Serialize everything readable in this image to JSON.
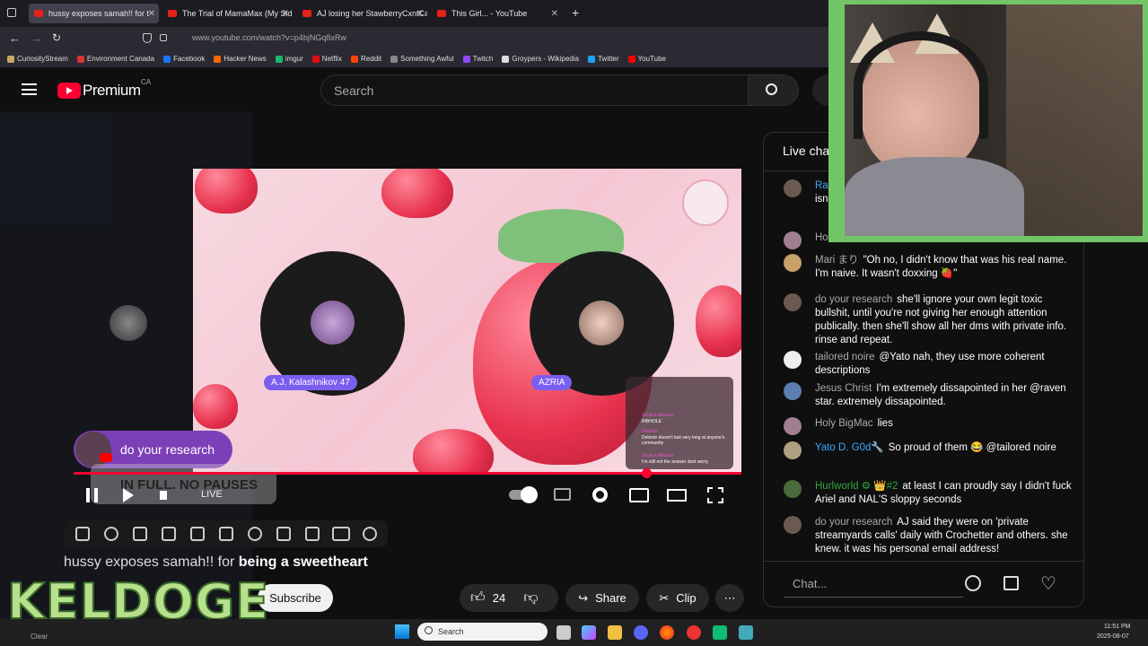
{
  "browser": {
    "tabs": [
      {
        "title": "hussy exposes samah!! for t",
        "active": true
      },
      {
        "title": "The Trial of MamaMax (My Side"
      },
      {
        "title": "AJ losing her StawberryCxntCal"
      },
      {
        "title": "This Girl... - YouTube"
      }
    ],
    "url": "www.youtube.com/watch?v=p4bjNGq8xRw",
    "bookmarks": [
      "CuriosityStream",
      "Environment Canada",
      "Facebook",
      "Hacker News",
      "imgur",
      "Netflix",
      "Reddit",
      "Something Awful",
      "Twitch",
      "Groypers - Wikipedia",
      "Twitter",
      "YouTube"
    ]
  },
  "youtube": {
    "logo": "Premium",
    "region": "CA",
    "search_placeholder": "Search",
    "video": {
      "left_name": "A.J. Kalashnikov 47",
      "right_name": "AZRIA",
      "overlay_badge": "do your research",
      "caption": "IN FULL. NO PAUSES",
      "live": "LIVE",
      "minichat": [
        {
          "name": "Jessica Mesaco",
          "text": "RIBHOLE"
        },
        {
          "name": "Donella",
          "text": "Delonte doesn't last very long at anyone's community"
        },
        {
          "name": "Jessica Mesaco",
          "text": "I'm still not the answer dont worry"
        }
      ]
    },
    "title_prefix": "hussy exposes samah!! for ",
    "title_bold": "being a sweetheart",
    "subscribe": "Subscribe",
    "likes": "24",
    "share": "Share",
    "clip": "Clip"
  },
  "watermark": "KELDOGE",
  "chat": {
    "header": "Live cha",
    "messages": [
      {
        "author": "Ra",
        "text": "isn and",
        "color": "#3ea6ff"
      },
      {
        "author": "Ho",
        "text": "",
        "color": "#aaa"
      },
      {
        "author": "Mari まり",
        "text": "\"Oh no, I didn't know that was his real name. I'm naive. It wasn't doxxing 🍓\"",
        "color": "#aaa"
      },
      {
        "author": "do your research",
        "text": "she'll ignore your own legit toxic bullshit, until you're not giving her enough attention publically. then she'll show all her dms with private info. rinse and repeat.",
        "color": "#aaa"
      },
      {
        "author": "tailored noire",
        "text": "@Yato nah, they use more coherent descriptions",
        "color": "#aaa"
      },
      {
        "author": "Jesus Christ",
        "text": "I'm extremely dissapointed in her @raven star. extremely dissapointed.",
        "color": "#aaa"
      },
      {
        "author": "Holy BigMac",
        "text": "lies",
        "color": "#aaa"
      },
      {
        "author": "Yato D. G0d🔧",
        "text": "So proud of them 😂 @tailored noire",
        "color": "#3ea6ff"
      },
      {
        "author": "Hurlworld ⚙ 👑#2",
        "text": "at least I can proudly say I didn't fuck Ariel and NAL'S sloppy seconds",
        "color": "#2ba640"
      },
      {
        "author": "do your research",
        "text": "AJ said they were on 'private streamyards calls' daily with Crochetter and others. she knew. it was his personal email address!",
        "color": "#aaa"
      }
    ],
    "input_placeholder": "Chat..."
  },
  "taskbar": {
    "search": "Search",
    "weather": "Clear",
    "time": "11:51 PM",
    "date": "2025-08-07"
  }
}
